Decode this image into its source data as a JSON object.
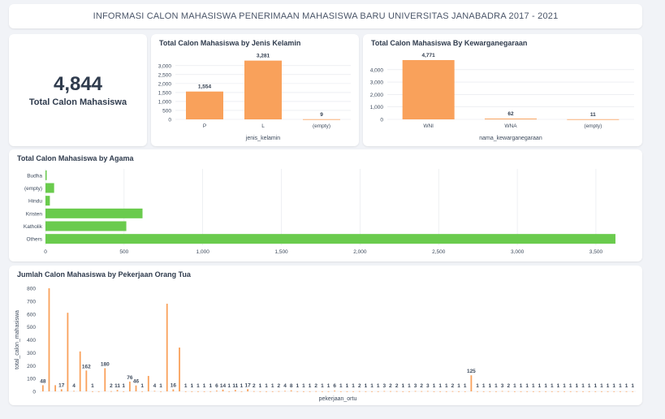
{
  "header": {
    "title": "INFORMASI CALON MAHASISWA PENERIMAAN MAHASISWA BARU UNIVERSITAS JANABADRA 2017 - 2021"
  },
  "kpi": {
    "value": "4,844",
    "label": "Total Calon Mahasiswa"
  },
  "colors": {
    "orange": "#f9a15b",
    "green": "#6acb4d",
    "grid": "#e3e6eb",
    "text": "#3d4a5c"
  },
  "chart_data": [
    {
      "id": "gender",
      "type": "bar",
      "title": "Total Calon Mahasiswa by Jenis Kelamin",
      "xlabel": "jenis_kelamin",
      "ylabel": "",
      "categories": [
        "P",
        "L",
        "(empty)"
      ],
      "values": [
        1554,
        3281,
        9
      ],
      "value_labels": [
        "1,554",
        "3,281",
        "9"
      ],
      "yticks": [
        0,
        500,
        1000,
        1500,
        2000,
        2500,
        3000
      ],
      "ytick_labels": [
        "0",
        "500",
        "1,000",
        "1,500",
        "2,000",
        "2,500",
        "3,000"
      ],
      "ylim": [
        0,
        3400
      ],
      "color": "#f9a15b"
    },
    {
      "id": "nation",
      "type": "bar",
      "title": "Total Calon Mahasiswa By Kewarganegaraan",
      "xlabel": "nama_kewarganegaraan",
      "ylabel": "",
      "categories": [
        "WNI",
        "WNA",
        "(empty)"
      ],
      "values": [
        4771,
        62,
        11
      ],
      "value_labels": [
        "4,771",
        "62",
        "11"
      ],
      "yticks": [
        0,
        1000,
        2000,
        3000,
        4000
      ],
      "ytick_labels": [
        "0",
        "1,000",
        "2,000",
        "3,000",
        "4,000"
      ],
      "ylim": [
        0,
        4900
      ],
      "color": "#f9a15b"
    },
    {
      "id": "religion",
      "type": "bar",
      "orientation": "horizontal",
      "title": "Total Calon Mahasiswa by Agama",
      "xlabel": "",
      "ylabel": "",
      "categories": [
        "Budha",
        "(empty)",
        "Hindu",
        "Kristen",
        "Katholik",
        "Others"
      ],
      "values": [
        6,
        55,
        28,
        617,
        514,
        3624
      ],
      "xticks": [
        0,
        500,
        1000,
        1500,
        2000,
        2500,
        3000,
        3500
      ],
      "xtick_labels": [
        "0",
        "500",
        "1,000",
        "1,500",
        "2,000",
        "2,500",
        "3,000",
        "3,500"
      ],
      "xlim": [
        0,
        3650
      ],
      "color": "#6acb4d"
    },
    {
      "id": "job",
      "type": "bar",
      "title": "Jumlah Calon Mahasiswa by Pekerjaan Orang Tua",
      "xlabel": "pekerjaan_ortu",
      "ylabel": "total_calon_mahasiswa",
      "yticks": [
        0,
        100,
        200,
        300,
        400,
        500,
        600,
        700,
        800
      ],
      "ytick_labels": [
        "0",
        "100",
        "200",
        "300",
        "400",
        "500",
        "600",
        "700",
        "800"
      ],
      "ylim": [
        0,
        800
      ],
      "color": "#f9a15b",
      "values": [
        48,
        800,
        48,
        17,
        610,
        4,
        310,
        162,
        1,
        1,
        180,
        2,
        11,
        1,
        76,
        46,
        1,
        120,
        4,
        1,
        680,
        16,
        340,
        1,
        1,
        1,
        1,
        1,
        6,
        14,
        1,
        11,
        1,
        17,
        2,
        1,
        1,
        1,
        2,
        4,
        8,
        1,
        1,
        1,
        2,
        1,
        1,
        6,
        1,
        1,
        1,
        2,
        1,
        1,
        1,
        3,
        2,
        2,
        1,
        1,
        3,
        2,
        3,
        1,
        1,
        1,
        2,
        1,
        1,
        125,
        1,
        1,
        1,
        1,
        3,
        2,
        1,
        1,
        1,
        1,
        1,
        1,
        1,
        1,
        1,
        1,
        1,
        1,
        1,
        1,
        1,
        1,
        1,
        1,
        1,
        1
      ],
      "value_labels": [
        "48",
        "",
        "",
        "17",
        "",
        "4",
        "",
        "162",
        "1",
        "",
        "180",
        "2",
        "11",
        "1",
        "76",
        "46",
        "1",
        "",
        "4",
        "1",
        "",
        "16",
        "",
        "1",
        "1",
        "1",
        "1",
        "1",
        "6",
        "14",
        "1",
        "11",
        "1",
        "17",
        "2",
        "1",
        "1",
        "1",
        "2",
        "4",
        "8",
        "1",
        "1",
        "1",
        "2",
        "1",
        "1",
        "6",
        "1",
        "1",
        "1",
        "2",
        "1",
        "1",
        "1",
        "3",
        "2",
        "2",
        "1",
        "1",
        "3",
        "2",
        "3",
        "1",
        "1",
        "1",
        "2",
        "1",
        "1",
        "125",
        "1",
        "1",
        "1",
        "1",
        "3",
        "2",
        "1",
        "1",
        "1",
        "1",
        "1",
        "1",
        "1",
        "1",
        "1",
        "1",
        "1",
        "1",
        "1",
        "1",
        "1",
        "1",
        "1",
        "1",
        "1",
        "1"
      ]
    }
  ]
}
